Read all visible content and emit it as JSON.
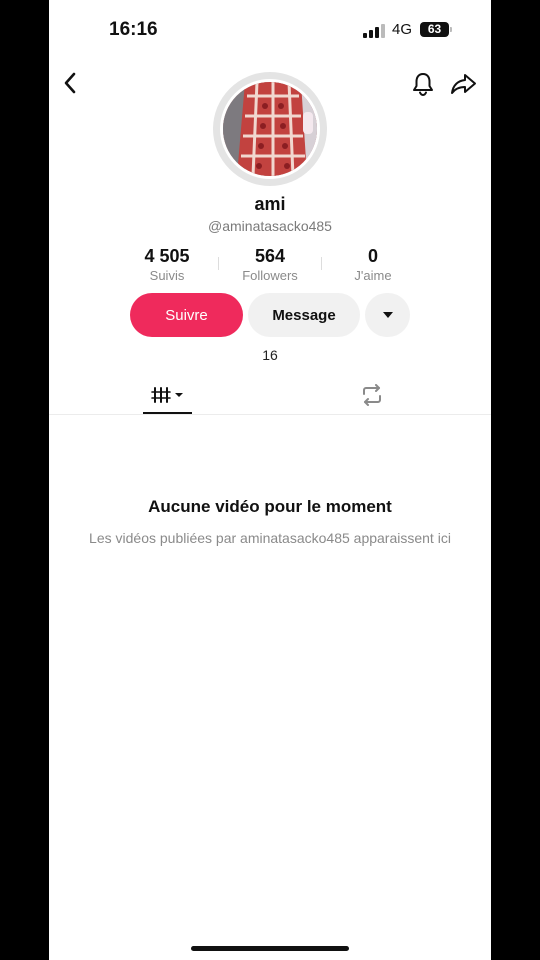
{
  "status_bar": {
    "time": "16:16",
    "network": "4G",
    "battery": "63"
  },
  "profile": {
    "display_name": "ami",
    "username": "@aminatasacko485"
  },
  "stats": [
    {
      "value": "4 505",
      "label": "Suivis"
    },
    {
      "value": "564",
      "label": "Followers"
    },
    {
      "value": "0",
      "label": "J'aime"
    }
  ],
  "actions": {
    "follow_label": "Suivre",
    "message_label": "Message"
  },
  "video_count": "16",
  "tabs": [
    {
      "icon": "videos-grid-icon",
      "active": true
    },
    {
      "icon": "repost-icon",
      "active": false
    }
  ],
  "empty_state": {
    "title": "Aucune vidéo pour le moment",
    "subtitle": "Les vidéos publiées par aminatasacko485 apparaissent ici"
  },
  "colors": {
    "follow_button": "#ef2a5c",
    "secondary_button": "#f1f1f1"
  }
}
